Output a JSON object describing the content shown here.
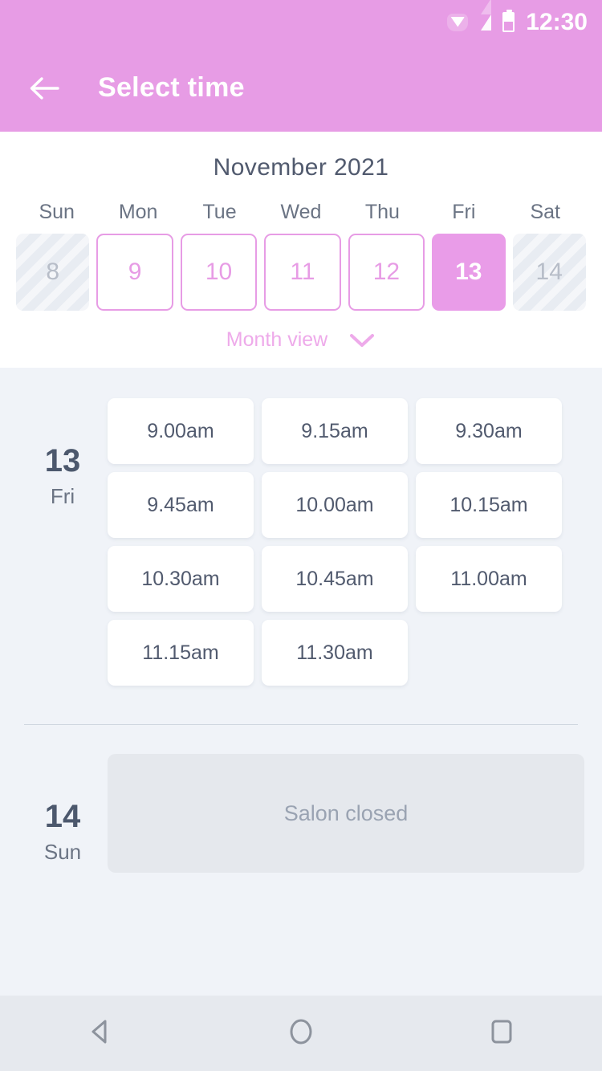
{
  "theme": {
    "accent": "#e79ce5",
    "accent_selected": "#e99ce8",
    "page_bg": "#f0f3f8",
    "card_bg": "#ffffff",
    "text_dark": "#4c586d",
    "text_muted": "#6b7484",
    "closed_panel_bg": "#e5e8ed",
    "disabled_cell_bg": "#e8ecf2",
    "navbar_bg": "#e6e9ee"
  },
  "statusbar": {
    "time": "12:30",
    "icons": [
      "wifi-icon",
      "cellular-signal-icon",
      "battery-icon"
    ]
  },
  "appbar": {
    "back_icon": "back-arrow-icon",
    "title": "Select time"
  },
  "calendar": {
    "month_label": "November 2021",
    "weekday_headers": [
      "Sun",
      "Mon",
      "Tue",
      "Wed",
      "Thu",
      "Fri",
      "Sat"
    ],
    "days": [
      {
        "number": "8",
        "state": "disabled"
      },
      {
        "number": "9",
        "state": "available"
      },
      {
        "number": "10",
        "state": "available"
      },
      {
        "number": "11",
        "state": "available"
      },
      {
        "number": "12",
        "state": "available"
      },
      {
        "number": "13",
        "state": "selected"
      },
      {
        "number": "14",
        "state": "disabled"
      }
    ],
    "month_view_label": "Month view",
    "month_view_icon": "chevron-down-icon"
  },
  "schedule": [
    {
      "day_number": "13",
      "day_weekday": "Fri",
      "slots": [
        "9.00am",
        "9.15am",
        "9.30am",
        "9.45am",
        "10.00am",
        "10.15am",
        "10.30am",
        "10.45am",
        "11.00am",
        "11.15am",
        "11.30am"
      ]
    },
    {
      "day_number": "14",
      "day_weekday": "Sun",
      "closed_message": "Salon closed"
    }
  ],
  "navbar": {
    "back_label": "back-triangle-icon",
    "home_label": "home-circle-icon",
    "recents_label": "recents-square-icon"
  }
}
